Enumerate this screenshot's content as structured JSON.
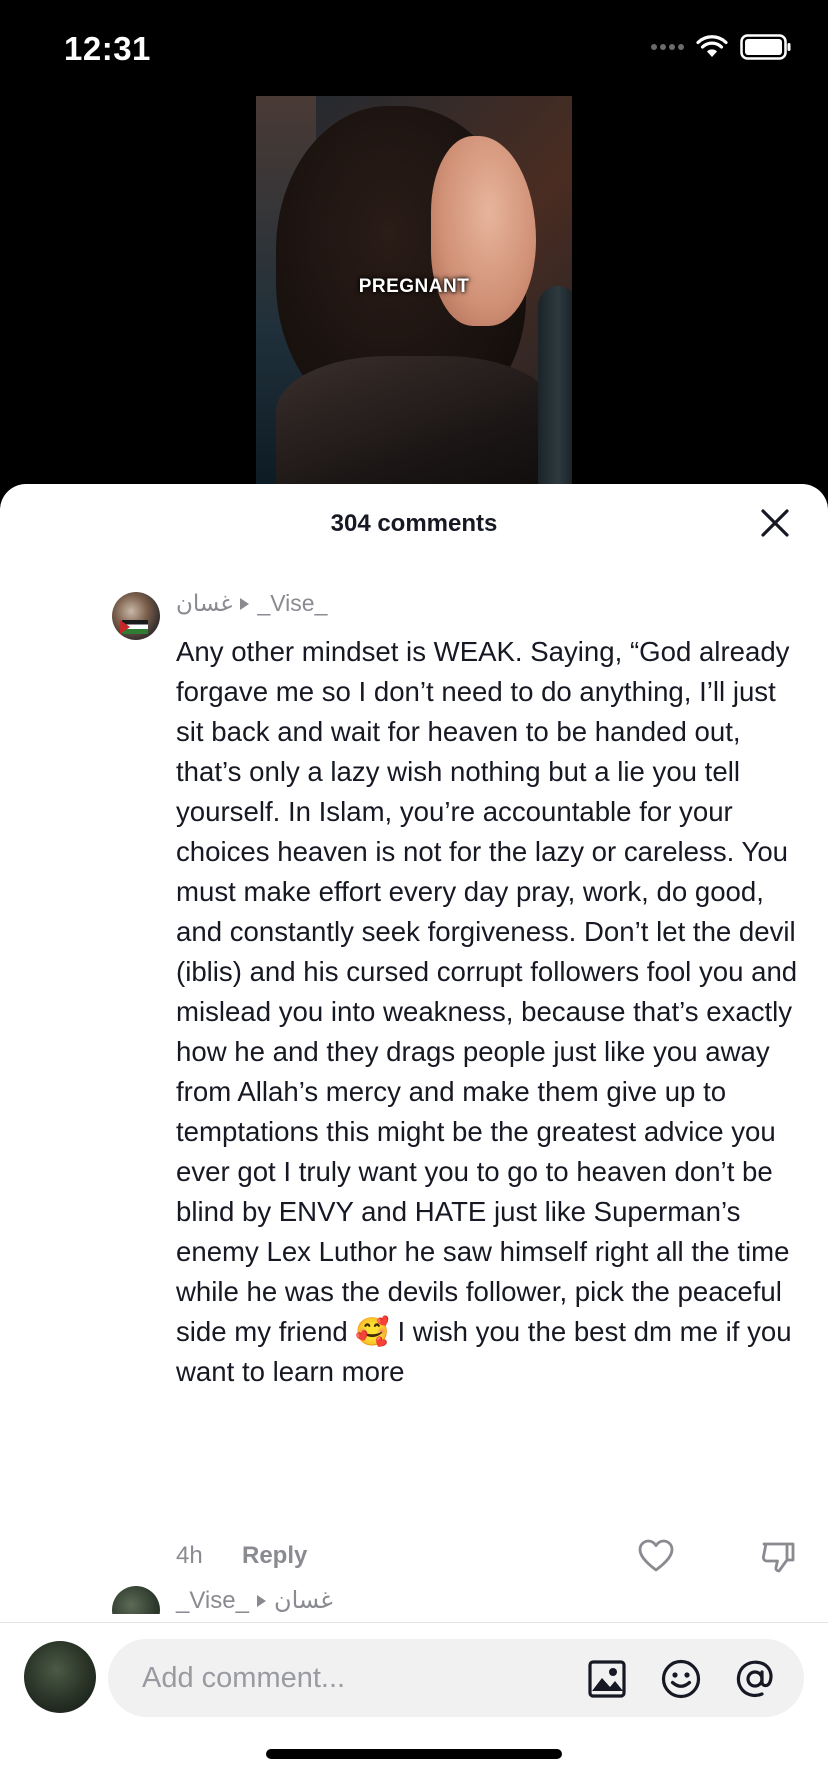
{
  "status_bar": {
    "time": "12:31"
  },
  "video": {
    "caption": "PREGNANT"
  },
  "sheet": {
    "title": "304 comments"
  },
  "comment": {
    "reply_to": "غسان",
    "author": "_Vise_",
    "text": "Any other mindset is WEAK. Saying, “God already forgave me so I don’t need to do anything, I’ll just sit back and wait for heaven to be handed out, that’s only a lazy wish nothing but a lie you tell yourself. In Islam, you’re accountable for your choices heaven is not for the lazy or careless. You must make effort every day pray, work, do good, and constantly seek forgiveness. Don’t let the devil (iblis) and his cursed corrupt followers fool you and mislead you into weakness, because that’s exactly how he and they drags people just like you away from Allah’s mercy and make them give up to temptations this might be the greatest advice you ever got I truly want you to go to heaven don’t be blind by ENVY and HATE just like Superman’s enemy Lex Luthor he saw himself right all the time while he was the devils follower, pick the peaceful side my friend 🥰 I wish you the best dm me if you want to learn more",
    "time": "4h",
    "reply_label": "Reply"
  },
  "next_comment": {
    "author": "_Vise_",
    "reply_to": "غسان"
  },
  "input": {
    "placeholder": "Add comment..."
  },
  "icons": [
    "close-icon",
    "heart-icon",
    "dislike-icon",
    "image-icon",
    "emoji-icon",
    "mention-icon"
  ]
}
